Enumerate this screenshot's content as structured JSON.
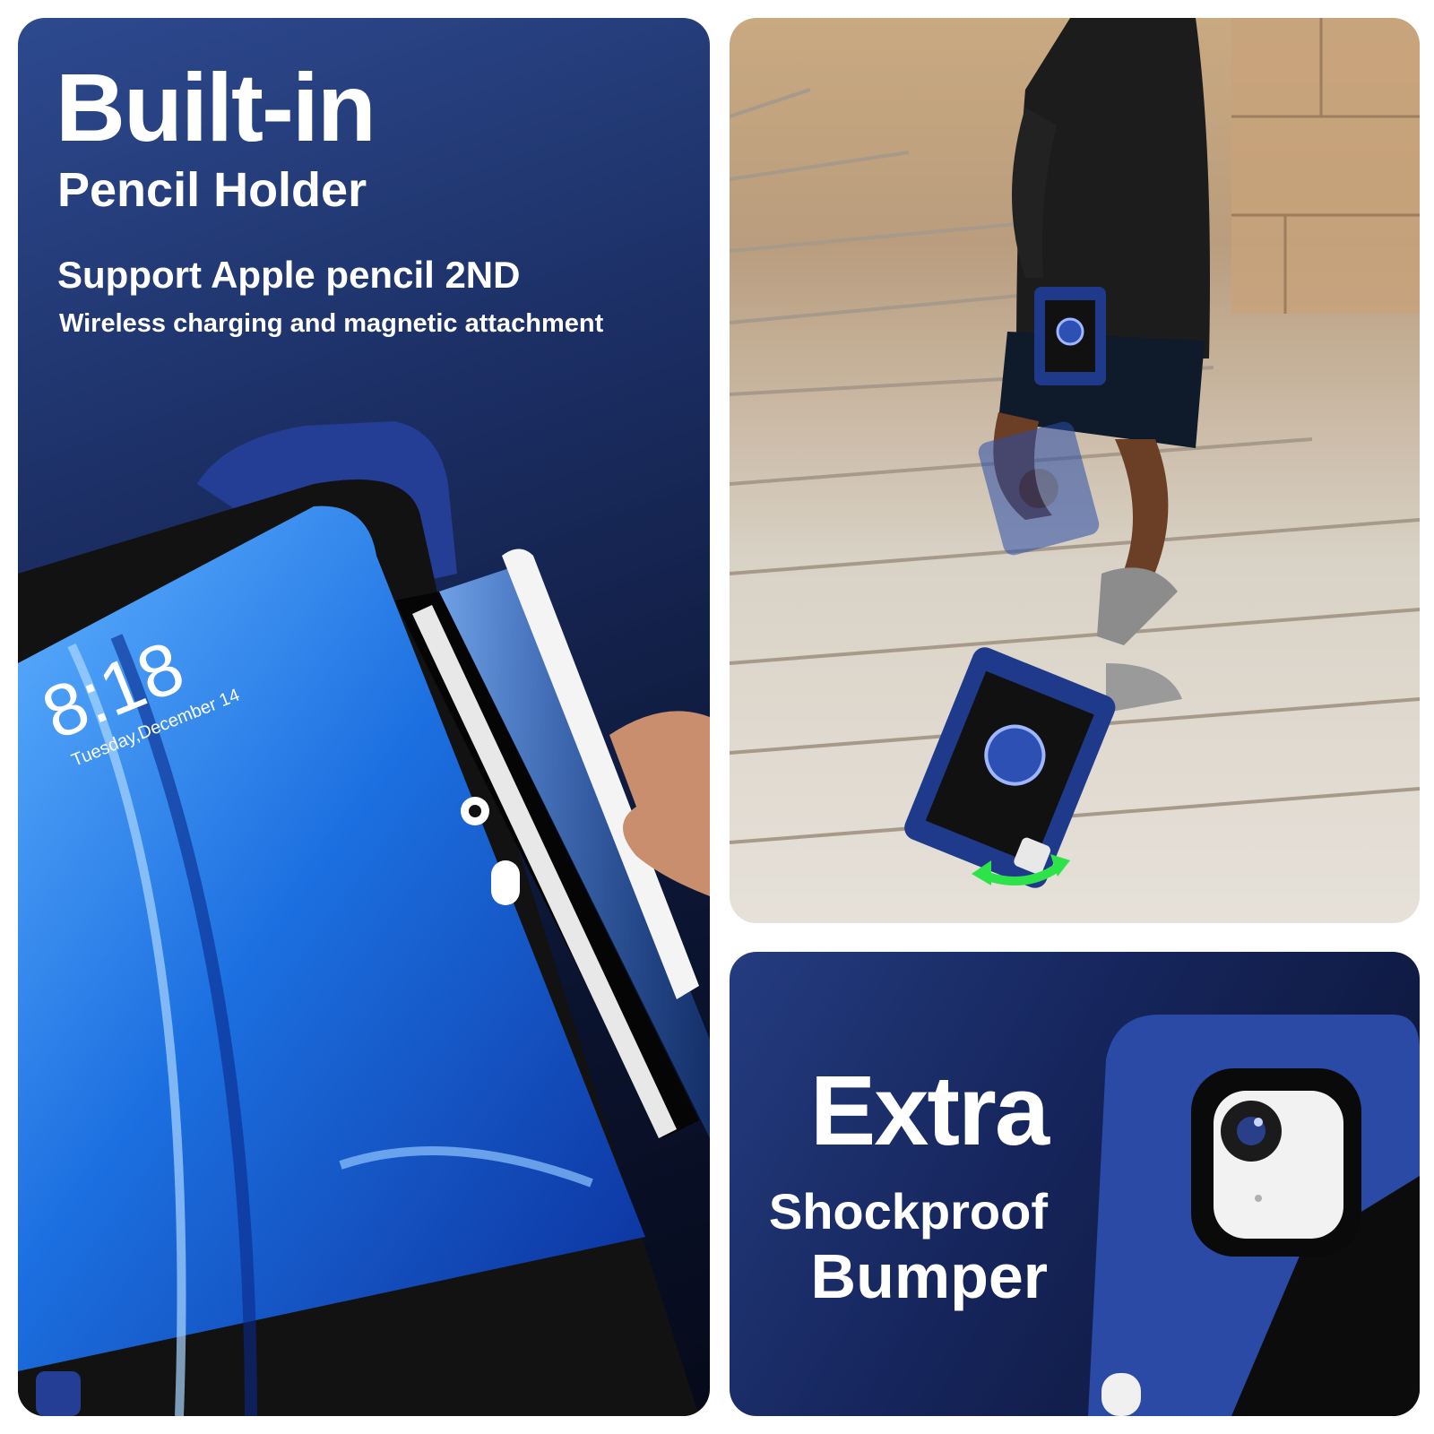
{
  "left_panel": {
    "heading": "Built-in",
    "subheading": "Pencil Holder",
    "feature": "Support Apple pencil 2ND",
    "feature_detail": "Wireless charging and magnetic attachment",
    "screen_time": "8:18",
    "screen_date": "Tuesday,December 14"
  },
  "bottom_right_panel": {
    "line1": "Extra",
    "line2": "Shockproof",
    "line3": "Bumper"
  },
  "colors": {
    "case_blue": "#1f3a8a",
    "case_black": "#111111",
    "text": "#ffffff",
    "accent_green": "#2ee34a"
  }
}
